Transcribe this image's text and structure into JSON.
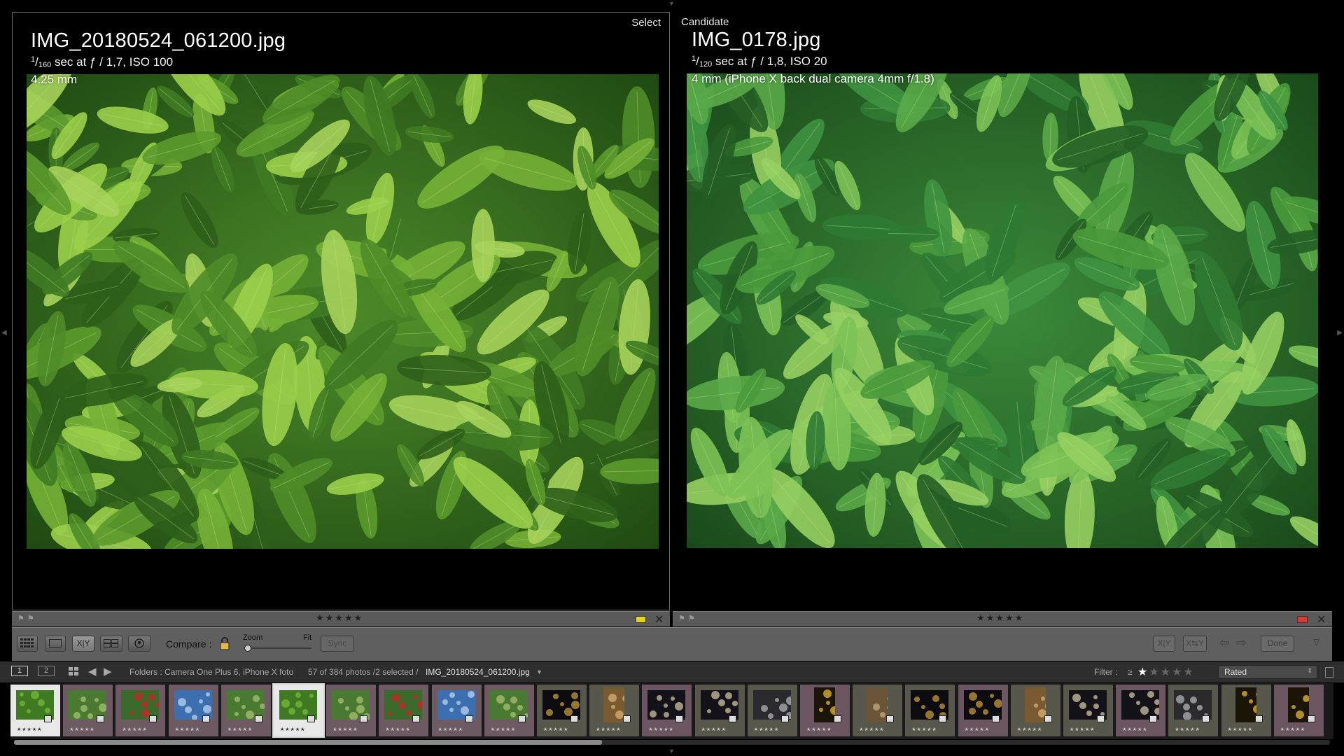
{
  "left_pane": {
    "tag": "Select",
    "title": "IMG_20180524_061200.jpg",
    "shutter_num": "1",
    "shutter_den": "160",
    "exif_rest": " sec at ƒ / 1,7, ISO 100",
    "focal": "4.25 mm",
    "stars": "★★★★★",
    "close": "✕",
    "label_color": "#e6d21f"
  },
  "right_pane": {
    "tag": "Candidate",
    "title": "IMG_0178.jpg",
    "shutter_num": "1",
    "shutter_den": "120",
    "exif_rest": " sec at ƒ / 1,8, ISO 20",
    "focal": "4 mm (iPhone X back dual camera 4mm f/1.8)",
    "stars": "★★★★★",
    "close": "✕",
    "label_color": "#d63a3a"
  },
  "toolbar": {
    "compare_label": "Compare :",
    "zoom_label": "Zoom",
    "fit_label": "Fit",
    "sync_label": "Sync",
    "xy_label": "X|Y",
    "swap_xy_label": "X⇆Y",
    "done_label": "Done",
    "zoom_level": 0
  },
  "filmstrip_header": {
    "screen1": "1",
    "screen2": "2",
    "source": "Folders : Camera One Plus 6, iPhone X foto",
    "count": "57 of 384 photos /2 selected /",
    "filename": "IMG_20180524_061200.jpg",
    "filter_label": "Filter :",
    "filter_op": "≥",
    "filter_stars": "★★★★★",
    "filter_value": "Rated"
  },
  "filmstrip": [
    {
      "kind": "leaves",
      "stars": "★★★★★"
    },
    {
      "kind": "garden",
      "stars": "★★★★★"
    },
    {
      "kind": "red",
      "stars": "★★★★★"
    },
    {
      "kind": "sky",
      "stars": "★★★★★"
    },
    {
      "kind": "garden",
      "stars": "★★★★★"
    },
    {
      "kind": "leaves",
      "stars": "★★★★★"
    },
    {
      "kind": "garden",
      "stars": "★★★★★"
    },
    {
      "kind": "red",
      "stars": "★★★★★"
    },
    {
      "kind": "sky",
      "stars": "★★★★★"
    },
    {
      "kind": "garden",
      "stars": "★★★★★"
    },
    {
      "kind": "night",
      "stars": "★★★★★"
    },
    {
      "kind": "arch",
      "stars": "★★★★★"
    },
    {
      "kind": "street",
      "stars": "★★★★★"
    },
    {
      "kind": "street",
      "stars": "★★★★★"
    },
    {
      "kind": "tunnel",
      "stars": "★★★★★"
    },
    {
      "kind": "flowers",
      "stars": "★★★★★"
    },
    {
      "kind": "wall",
      "stars": "★★★★★"
    },
    {
      "kind": "night",
      "stars": "★★★★★"
    },
    {
      "kind": "night",
      "stars": "★★★★★"
    },
    {
      "kind": "arch",
      "stars": "★★★★★"
    },
    {
      "kind": "street",
      "stars": "★★★★★"
    },
    {
      "kind": "street",
      "stars": "★★★★★"
    },
    {
      "kind": "tunnel",
      "stars": "★★★★★"
    },
    {
      "kind": "flowers",
      "stars": "★★★★★"
    },
    {
      "kind": "flowers",
      "stars": "★★★★★"
    }
  ]
}
